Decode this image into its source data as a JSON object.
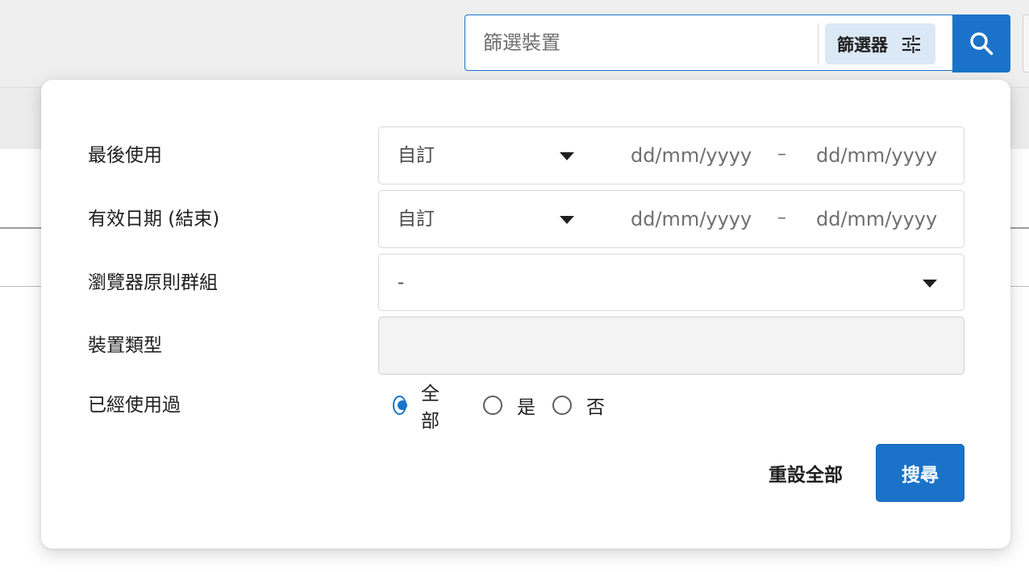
{
  "search": {
    "placeholder": "篩選裝置",
    "filter_label": "篩選器"
  },
  "icons": {
    "search": "search-icon",
    "filter": "sliders-icon",
    "caret": "caret-down-icon"
  },
  "colors": {
    "accent": "#1a73c9",
    "chip_background": "#dbe9f7",
    "disabled_field": "#f3f3f3"
  },
  "panel": {
    "rows": [
      {
        "label": "最後使用",
        "select_value": "自訂",
        "date_from": "dd/mm/yyyy",
        "separator": "–",
        "date_to": "dd/mm/yyyy"
      },
      {
        "label": "有效日期 (結束)",
        "select_value": "自訂",
        "date_from": "dd/mm/yyyy",
        "separator": "–",
        "date_to": "dd/mm/yyyy"
      },
      {
        "label": "瀏覽器原則群組",
        "select_value": "-"
      },
      {
        "label": "裝置類型",
        "select_value": ""
      },
      {
        "label": "已經使用過",
        "options": [
          {
            "label": "全部",
            "selected": true
          },
          {
            "label": "是",
            "selected": false
          },
          {
            "label": "否",
            "selected": false
          }
        ]
      }
    ],
    "reset_label": "重設全部",
    "submit_label": "搜尋"
  }
}
